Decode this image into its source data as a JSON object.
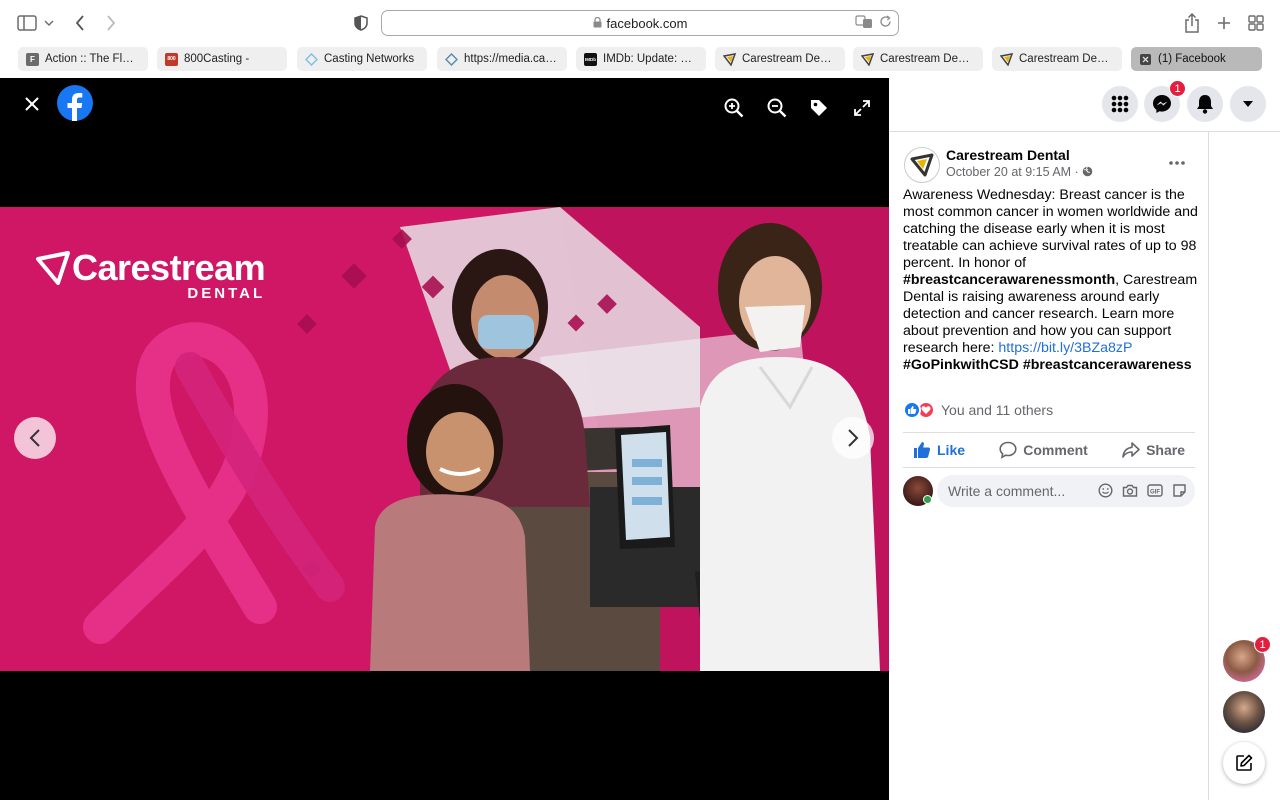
{
  "browser": {
    "url": "facebook.com",
    "tabs": [
      {
        "label": "Action :: The Flor...",
        "favicon": "F",
        "favicon_color": "#6b6b6b"
      },
      {
        "label": "800Casting -",
        "favicon": "800",
        "favicon_color": "#c0392b"
      },
      {
        "label": "Casting Networks",
        "favicon": "",
        "favicon_color": "#9ecfe8"
      },
      {
        "label": "https://media.cas...",
        "favicon": "",
        "favicon_color": "#9ecfe8"
      },
      {
        "label": "IMDb: Update: St...",
        "favicon": "IMDb",
        "favicon_color": "#111111"
      },
      {
        "label": "Carestream Dent...",
        "favicon": "",
        "favicon_color": "#444444"
      },
      {
        "label": "Carestream Dent...",
        "favicon": "",
        "favicon_color": "#444444"
      },
      {
        "label": "Carestream Dent...",
        "favicon": "",
        "favicon_color": "#444444"
      },
      {
        "label": "(1) Facebook",
        "favicon": "",
        "favicon_color": "#333333"
      }
    ]
  },
  "photo": {
    "brand_name": "Carestream",
    "brand_sub": "DENTAL",
    "brand_color": "#d8186c"
  },
  "header": {
    "messenger_badge": "1"
  },
  "post": {
    "author": "Carestream Dental",
    "date": "October 20 at 9:15 AM ·",
    "text_1": "Awareness Wednesday: Breast cancer is the most common cancer in women worldwide and catching the disease early when it is most treatable can achieve survival rates of up to 98 percent. In honor of ",
    "hashtag_1": "#breastcancerawarenessmonth",
    "text_2": ", Carestream Dental is raising awareness around early detection and cancer research. Learn more about prevention and how you can support research here: ",
    "link": "https://bit.ly/3BZa8zP",
    "hashtag_2": "#GoPinkwithCSD",
    "hashtag_3": "#breastcancerawareness",
    "reactions_text": "You and 11 others",
    "like_label": "Like",
    "comment_label": "Comment",
    "share_label": "Share",
    "comment_placeholder": "Write a comment..."
  },
  "rail": {
    "chat_badge": "1"
  },
  "colors": {
    "facebook_blue": "#1877f2",
    "link_blue": "#216fdb",
    "pink": "#d8186c",
    "badge_red": "#e41e3f"
  }
}
